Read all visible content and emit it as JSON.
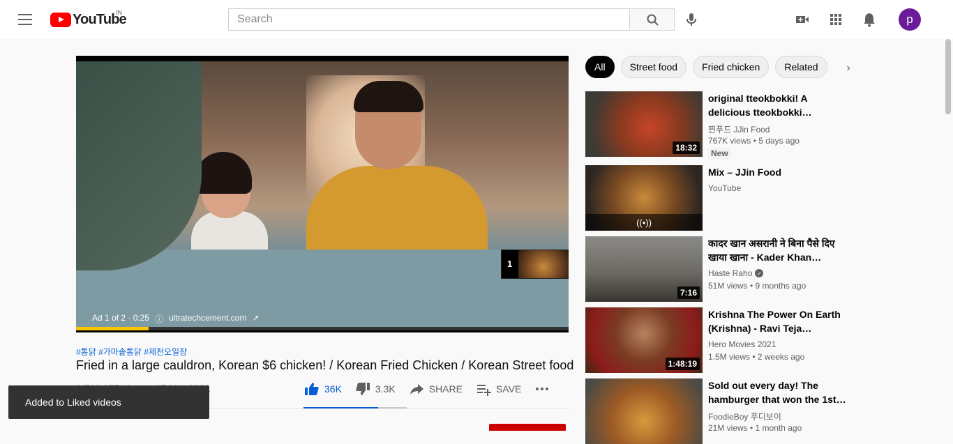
{
  "header": {
    "logo_text": "YouTube",
    "region": "IN",
    "search_placeholder": "Search",
    "avatar_letter": "p"
  },
  "player": {
    "ad_label": "Ad 1 of 2 · 0:25",
    "ad_domain": "ultratechcement.com",
    "ad_queue_number": "1",
    "progress_fraction": 0.147
  },
  "video": {
    "hashtags": "#통닭 #가마솥통닭 #제천오일장",
    "title": "Fried in a large cauldron, Korean $6 chicken! / Korean Fried Chicken / Korean Street food",
    "views_partial": "1,703,975 views · 17 Mar 2021",
    "actions": {
      "like_count": "36K",
      "dislike_count": "3.3K",
      "share_label": "SHARE",
      "save_label": "SAVE"
    }
  },
  "toast": {
    "message": "Added to Liked videos"
  },
  "chips": [
    "All",
    "Street food",
    "Fried chicken",
    "Related"
  ],
  "recommendations": [
    {
      "title": "original tteokbokki! A delicious tteokbokki restaurant…",
      "channel": "찐푸드 JJin Food",
      "meta": "767K views • 5 days ago",
      "badge": "New",
      "duration": "18:32"
    },
    {
      "title": "Mix – JJin Food",
      "channel": "YouTube",
      "meta": "",
      "badge": "",
      "duration": ""
    },
    {
      "title": "कादर खान असरानी ने बिना पैसे दिए खाया खाना - Kader Khan Asran…",
      "channel": "Haste Raho",
      "meta": "51M views • 9 months ago",
      "badge": "",
      "duration": "7:16"
    },
    {
      "title": "Krishna The Power On Earth (Krishna) - Ravi Teja…",
      "channel": "Hero Movies 2021",
      "meta": "1.5M views • 2 weeks ago",
      "badge": "",
      "duration": "1:48:19"
    },
    {
      "title": "Sold out every day! The hamburger that won the 1st…",
      "channel": "FoodieBoy 푸디보이",
      "meta": "21M views • 1 month ago",
      "badge": "",
      "duration": ""
    }
  ],
  "colors": {
    "brand_red": "#ff0000",
    "link_blue": "#065fd4",
    "ad_progress": "#fcc500",
    "avatar_bg": "#6a1b9a"
  }
}
